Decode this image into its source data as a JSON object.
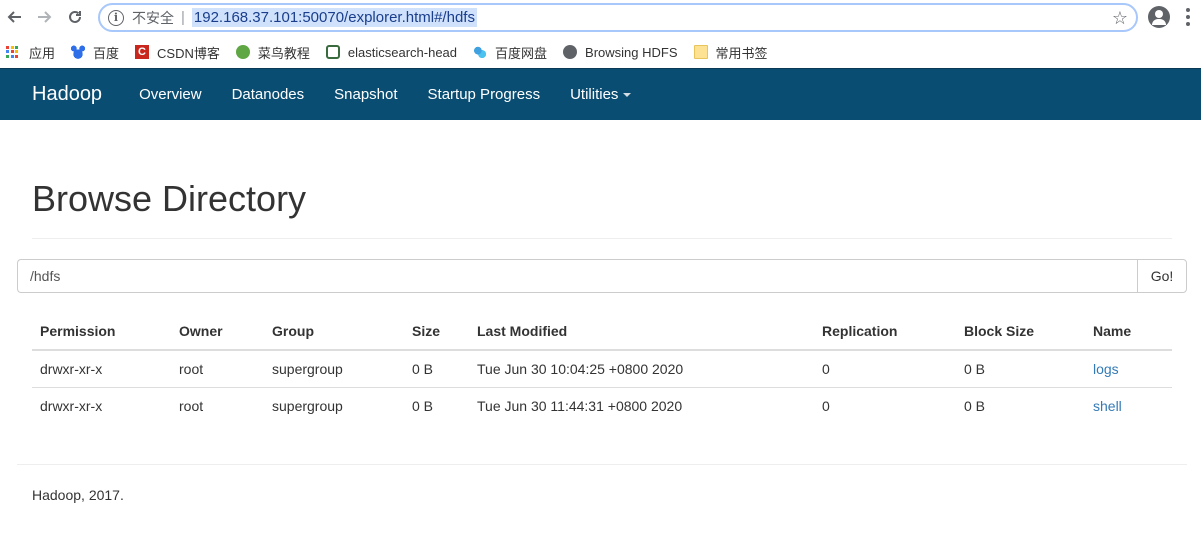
{
  "browser": {
    "security_label": "不安全",
    "url": "192.168.37.101:50070/explorer.html#/hdfs",
    "bookmarks": [
      {
        "label": "应用",
        "icon": "apps-grid-icon"
      },
      {
        "label": "百度",
        "icon": "baidu-paw-icon"
      },
      {
        "label": "CSDN博客",
        "icon": "csdn-icon"
      },
      {
        "label": "菜鸟教程",
        "icon": "runoob-icon"
      },
      {
        "label": "elasticsearch-head",
        "icon": "elasticsearch-icon"
      },
      {
        "label": "百度网盘",
        "icon": "baidu-pan-icon"
      },
      {
        "label": "Browsing HDFS",
        "icon": "globe-icon"
      },
      {
        "label": "常用书签",
        "icon": "folder-icon"
      }
    ]
  },
  "navbar": {
    "brand": "Hadoop",
    "links": [
      "Overview",
      "Datanodes",
      "Snapshot",
      "Startup Progress",
      "Utilities"
    ],
    "bg_color": "#0a4d72"
  },
  "page": {
    "title": "Browse Directory",
    "path_value": "/hdfs",
    "go_label": "Go!"
  },
  "table": {
    "headers": [
      "Permission",
      "Owner",
      "Group",
      "Size",
      "Last Modified",
      "Replication",
      "Block Size",
      "Name"
    ],
    "rows": [
      [
        "drwxr-xr-x",
        "root",
        "supergroup",
        "0 B",
        "Tue Jun 30 10:04:25 +0800 2020",
        "0",
        "0 B",
        "logs"
      ],
      [
        "drwxr-xr-x",
        "root",
        "supergroup",
        "0 B",
        "Tue Jun 30 11:44:31 +0800 2020",
        "0",
        "0 B",
        "shell"
      ]
    ]
  },
  "footer": "Hadoop, 2017."
}
